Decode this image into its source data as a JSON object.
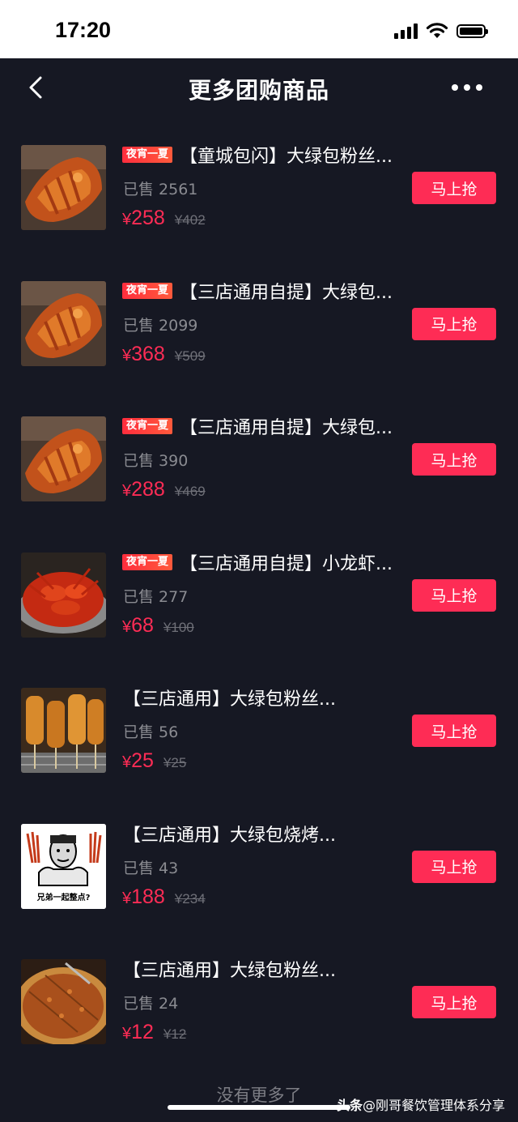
{
  "status_bar": {
    "time": "17:20"
  },
  "nav": {
    "title": "更多团购商品"
  },
  "items": [
    {
      "badge": "夜宵一夏",
      "title": "【童城包闪】大绿包粉丝...",
      "sold": "已售 2561",
      "yen": "¥",
      "price": "258",
      "original_price": "¥402",
      "button": "马上抢",
      "image": "grilled-fish"
    },
    {
      "badge": "夜宵一夏",
      "title": "【三店通用自提】大绿包...",
      "sold": "已售 2099",
      "yen": "¥",
      "price": "368",
      "original_price": "¥509",
      "button": "马上抢",
      "image": "grilled-fish"
    },
    {
      "badge": "夜宵一夏",
      "title": "【三店通用自提】大绿包...",
      "sold": "已售 390",
      "yen": "¥",
      "price": "288",
      "original_price": "¥469",
      "button": "马上抢",
      "image": "grilled-fish"
    },
    {
      "badge": "夜宵一夏",
      "title": "【三店通用自提】小龙虾...",
      "sold": "已售 277",
      "yen": "¥",
      "price": "68",
      "original_price": "¥100",
      "button": "马上抢",
      "image": "crayfish"
    },
    {
      "badge": "",
      "title": "【三店通用】大绿包粉丝...",
      "sold": "已售 56",
      "yen": "¥",
      "price": "25",
      "original_price": "¥25",
      "button": "马上抢",
      "image": "skewers"
    },
    {
      "badge": "",
      "title": "【三店通用】大绿包烧烤...",
      "sold": "已售 43",
      "yen": "¥",
      "price": "188",
      "original_price": "¥234",
      "button": "马上抢",
      "image": "meme",
      "image_caption": "兄弟一起整点?"
    },
    {
      "badge": "",
      "title": "【三店通用】大绿包粉丝...",
      "sold": "已售 24",
      "yen": "¥",
      "price": "12",
      "original_price": "¥12",
      "button": "马上抢",
      "image": "pizza"
    }
  ],
  "footer": {
    "no_more": "没有更多了"
  },
  "watermark": {
    "brand": "头条",
    "text": "@刚哥餐饮管理体系分享"
  },
  "colors": {
    "background": "#161823",
    "accent": "#fe2c55",
    "muted": "#8a8b91"
  }
}
